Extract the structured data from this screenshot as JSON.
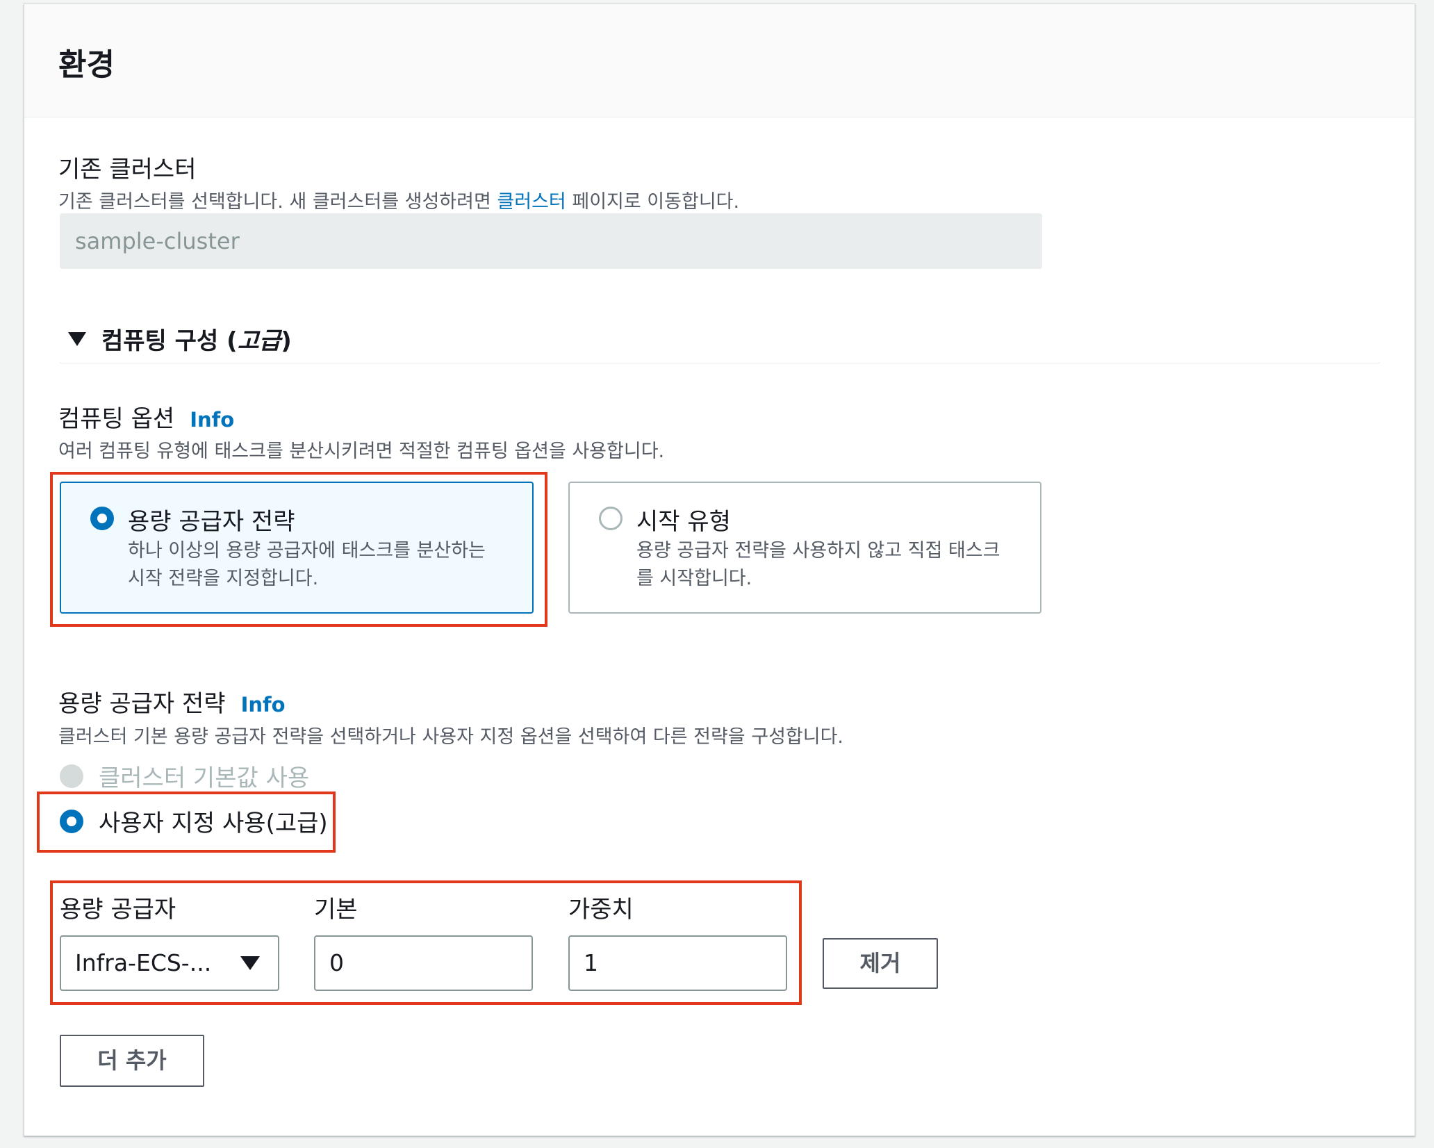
{
  "panel": {
    "title": "환경"
  },
  "cluster": {
    "label": "기존 클러스터",
    "desc_before": "기존 클러스터를 선택합니다. 새 클러스터를 생성하려면 ",
    "desc_link": "클러스터",
    "desc_after": " 페이지로 이동합니다.",
    "value": "sample-cluster"
  },
  "expander": {
    "label": "컴퓨팅 구성 (",
    "label_italic": "고급",
    "label_end": ")"
  },
  "compute_options": {
    "label": "컴퓨팅 옵션",
    "info": "Info",
    "desc": "여러 컴퓨팅 유형에 태스크를 분산시키려면 적절한 컴퓨팅 옵션을 사용합니다.",
    "tiles": [
      {
        "title": "용량 공급자 전략",
        "desc_line1": "하나 이상의 용량 공급자에 태스크를 분산하는",
        "desc_line2": "시작 전략을 지정합니다.",
        "selected": true
      },
      {
        "title": "시작 유형",
        "desc_line1": "용량 공급자 전략을 사용하지 않고 직접 태스크",
        "desc_line2": "를 시작합니다.",
        "selected": false
      }
    ]
  },
  "strategy": {
    "label": "용량 공급자 전략",
    "info": "Info",
    "desc": "클러스터 기본 용량 공급자 전략을 선택하거나 사용자 지정 옵션을 선택하여 다른 전략을 구성합니다.",
    "options": [
      {
        "label": "클러스터 기본값 사용",
        "state": "disabled"
      },
      {
        "label": "사용자 지정 사용(고급)",
        "state": "checked"
      }
    ]
  },
  "provider_row": {
    "provider_label": "용량 공급자",
    "base_label": "기본",
    "weight_label": "가중치",
    "provider_value": "Infra-ECS-...",
    "base_value": "0",
    "weight_value": "1",
    "remove_label": "제거"
  },
  "add_more_label": "더 추가",
  "colors": {
    "accent": "#0073bb",
    "highlight": "#e1381b"
  }
}
